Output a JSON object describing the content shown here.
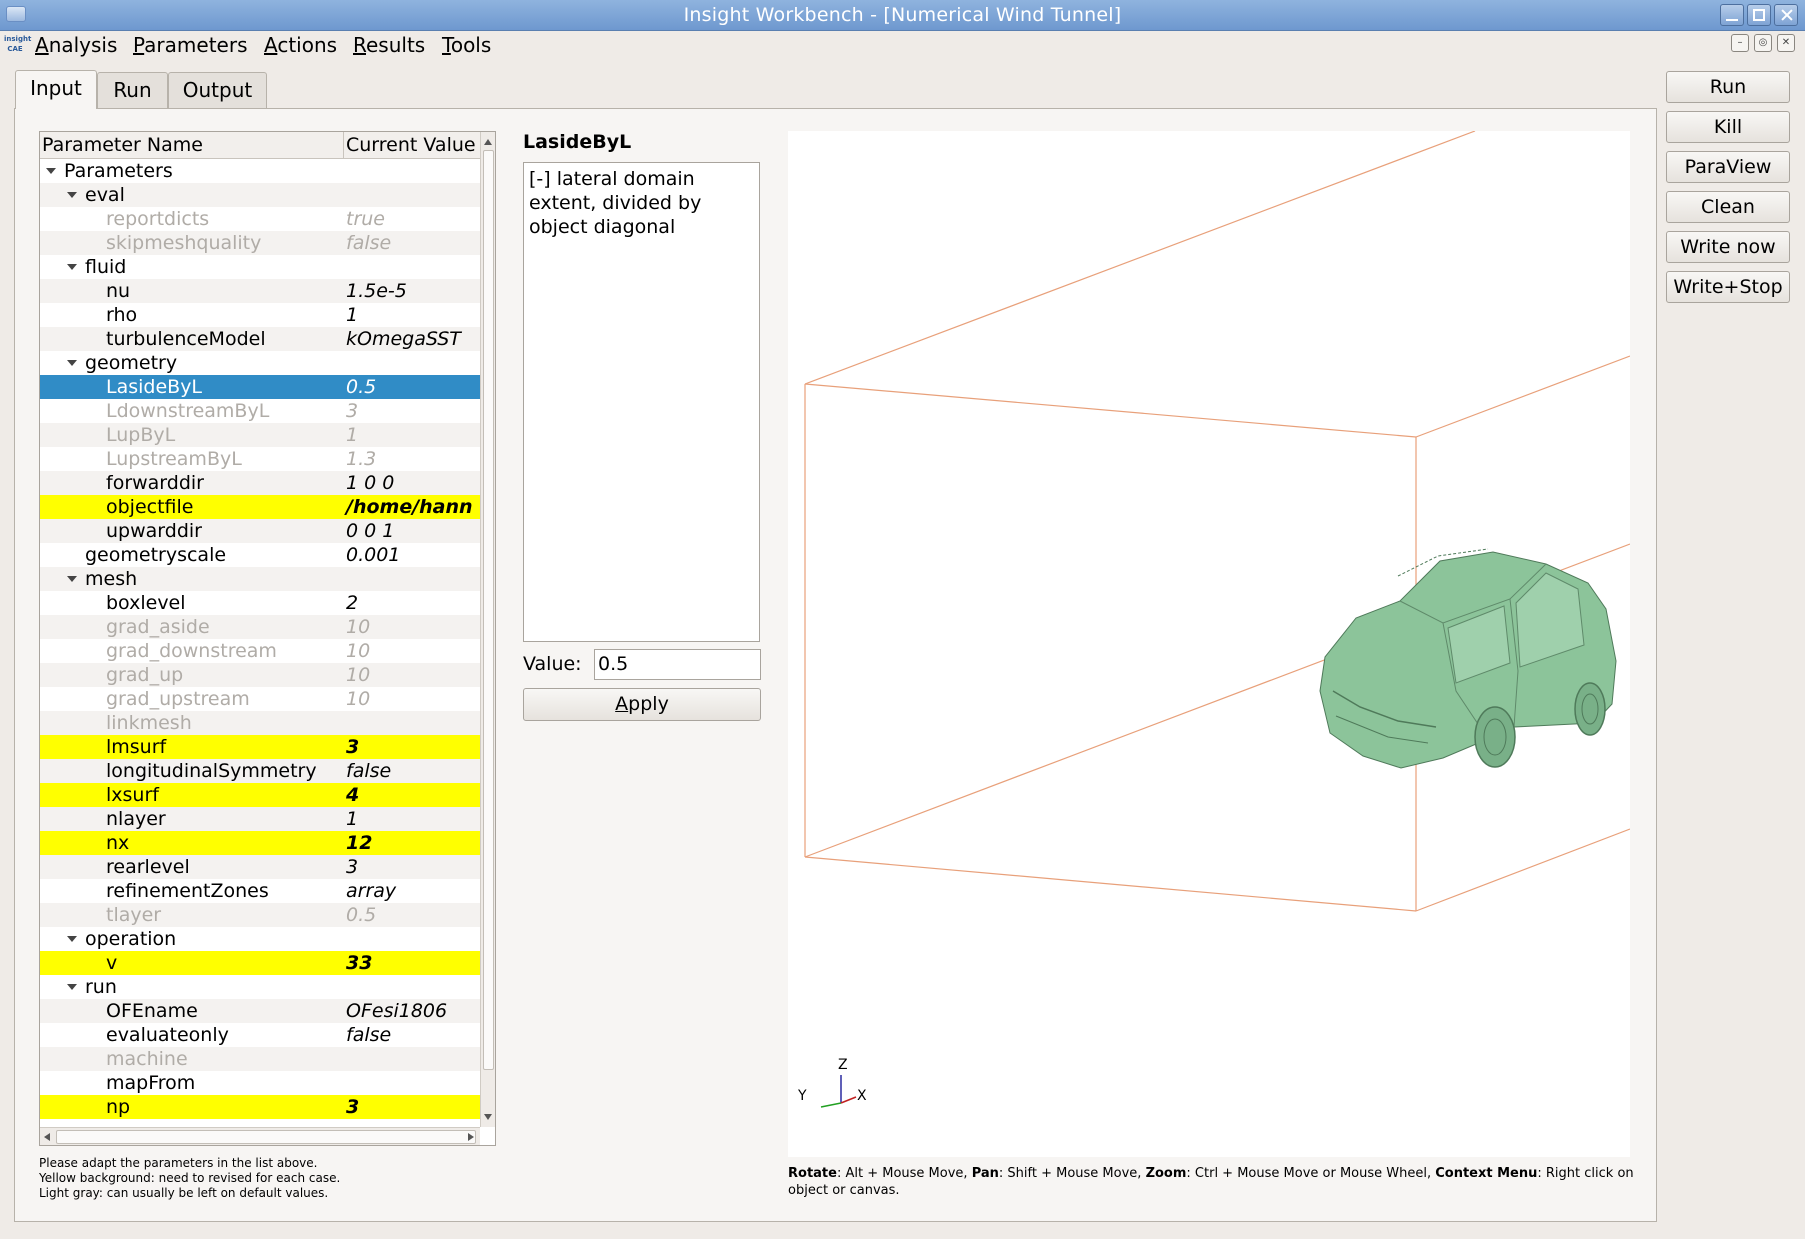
{
  "window": {
    "title": "Insight Workbench - [Numerical Wind Tunnel]"
  },
  "menu": [
    {
      "label": "Analysis",
      "mnemonic": "A"
    },
    {
      "label": "Parameters",
      "mnemonic": "P"
    },
    {
      "label": "Actions",
      "mnemonic": "A"
    },
    {
      "label": "Results",
      "mnemonic": "R"
    },
    {
      "label": "Tools",
      "mnemonic": "T"
    }
  ],
  "logo_text": "insight CAE",
  "tabs": [
    {
      "label": "Input",
      "active": true
    },
    {
      "label": "Run",
      "active": false
    },
    {
      "label": "Output",
      "active": false
    }
  ],
  "tree": {
    "columns": [
      "Parameter Name",
      "Current Value"
    ],
    "rows": [
      {
        "name": "Parameters",
        "value": "",
        "level": 0,
        "expanded": true,
        "style": "normal"
      },
      {
        "name": "eval",
        "value": "",
        "level": 1,
        "expanded": true,
        "style": "normal"
      },
      {
        "name": "reportdicts",
        "value": "true",
        "level": 2,
        "style": "gray"
      },
      {
        "name": "skipmeshquality",
        "value": "false",
        "level": 2,
        "style": "gray"
      },
      {
        "name": "fluid",
        "value": "",
        "level": 1,
        "expanded": true,
        "style": "normal"
      },
      {
        "name": "nu",
        "value": "1.5e-5",
        "level": 2,
        "style": "normal"
      },
      {
        "name": "rho",
        "value": "1",
        "level": 2,
        "style": "normal"
      },
      {
        "name": "turbulenceModel",
        "value": "kOmegaSST",
        "level": 2,
        "style": "normal"
      },
      {
        "name": "geometry",
        "value": "",
        "level": 1,
        "expanded": true,
        "style": "normal"
      },
      {
        "name": "LasideByL",
        "value": "0.5",
        "level": 2,
        "style": "selected"
      },
      {
        "name": "LdownstreamByL",
        "value": "3",
        "level": 2,
        "style": "gray"
      },
      {
        "name": "LupByL",
        "value": "1",
        "level": 2,
        "style": "gray"
      },
      {
        "name": "LupstreamByL",
        "value": "1.3",
        "level": 2,
        "style": "gray"
      },
      {
        "name": "forwarddir",
        "value": "1 0 0",
        "level": 2,
        "style": "normal"
      },
      {
        "name": "objectfile",
        "value": "/home/hann",
        "level": 2,
        "style": "yellow"
      },
      {
        "name": "upwarddir",
        "value": "0 0 1",
        "level": 2,
        "style": "normal"
      },
      {
        "name": "geometryscale",
        "value": "0.001",
        "level": 1,
        "style": "normal"
      },
      {
        "name": "mesh",
        "value": "",
        "level": 1,
        "expanded": true,
        "style": "normal"
      },
      {
        "name": "boxlevel",
        "value": "2",
        "level": 2,
        "style": "normal"
      },
      {
        "name": "grad_aside",
        "value": "10",
        "level": 2,
        "style": "gray"
      },
      {
        "name": "grad_downstream",
        "value": "10",
        "level": 2,
        "style": "gray"
      },
      {
        "name": "grad_up",
        "value": "10",
        "level": 2,
        "style": "gray"
      },
      {
        "name": "grad_upstream",
        "value": "10",
        "level": 2,
        "style": "gray"
      },
      {
        "name": "linkmesh",
        "value": "",
        "level": 2,
        "style": "gray"
      },
      {
        "name": "lmsurf",
        "value": "3",
        "level": 2,
        "style": "yellow"
      },
      {
        "name": "longitudinalSymmetry",
        "value": "false",
        "level": 2,
        "style": "normal"
      },
      {
        "name": "lxsurf",
        "value": "4",
        "level": 2,
        "style": "yellow"
      },
      {
        "name": "nlayer",
        "value": "1",
        "level": 2,
        "style": "normal"
      },
      {
        "name": "nx",
        "value": "12",
        "level": 2,
        "style": "yellow"
      },
      {
        "name": "rearlevel",
        "value": "3",
        "level": 2,
        "style": "normal"
      },
      {
        "name": "refinementZones",
        "value": "array",
        "level": 2,
        "style": "normal"
      },
      {
        "name": "tlayer",
        "value": "0.5",
        "level": 2,
        "style": "gray"
      },
      {
        "name": "operation",
        "value": "",
        "level": 1,
        "expanded": true,
        "style": "normal"
      },
      {
        "name": "v",
        "value": "33",
        "level": 2,
        "style": "yellow"
      },
      {
        "name": "run",
        "value": "",
        "level": 1,
        "expanded": true,
        "style": "normal"
      },
      {
        "name": "OFEname",
        "value": "OFesi1806",
        "level": 2,
        "style": "normal"
      },
      {
        "name": "evaluateonly",
        "value": "false",
        "level": 2,
        "style": "normal"
      },
      {
        "name": "machine",
        "value": "",
        "level": 2,
        "style": "gray"
      },
      {
        "name": "mapFrom",
        "value": "",
        "level": 2,
        "style": "normal"
      },
      {
        "name": "np",
        "value": "3",
        "level": 2,
        "style": "yellow"
      }
    ]
  },
  "hints": [
    "Please adapt the parameters in the list above.",
    "Yellow background: need to revised for each case.",
    "Light gray: can usually be left on default values."
  ],
  "detail": {
    "param_name": "LasideByL",
    "description": "[-] lateral domain extent, divided by object diagonal",
    "value_label": "Value:",
    "value": "0.5",
    "apply_label": "Apply",
    "apply_mnemonic": "A"
  },
  "viewer": {
    "axes": {
      "z": "Z",
      "y": "Y",
      "x": "X"
    },
    "domain_color": "#e8a07a",
    "object_color": "#8cc49a"
  },
  "help": [
    {
      "bold": "Rotate",
      "text": ": Alt + Mouse Move, "
    },
    {
      "bold": "Pan",
      "text": ": Shift + Mouse Move, "
    },
    {
      "bold": "Zoom",
      "text": ": Ctrl + Mouse Move or Mouse Wheel, "
    },
    {
      "bold": "Context Menu",
      "text": ": Right click on object or canvas."
    }
  ],
  "side_buttons": [
    "Run",
    "Kill",
    "ParaView",
    "Clean",
    "Write now",
    "Write+Stop"
  ],
  "colors": {
    "selection": "#308cc6",
    "highlight": "#ffff00",
    "titlebar": "#7aa2d6"
  }
}
